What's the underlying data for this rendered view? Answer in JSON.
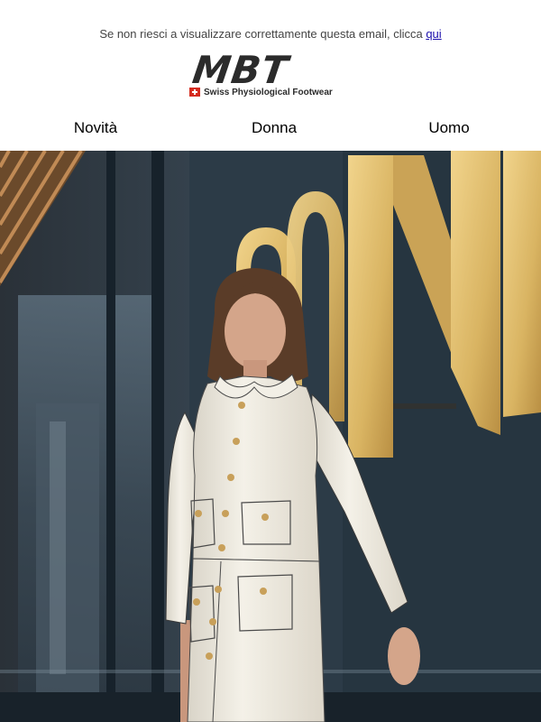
{
  "preheader": {
    "text": "Se non riesci a visualizzare correttamente questa email, clicca",
    "link": "qui"
  },
  "brand": {
    "name": "MBT",
    "tagline": "Swiss Physiological Footwear",
    "flag_color": "#d52b1e",
    "text_color": "#2b2b2b"
  },
  "nav": {
    "items": [
      {
        "label": "Novità"
      },
      {
        "label": "Donna"
      },
      {
        "label": "Uomo"
      }
    ]
  },
  "hero": {
    "signage_letters": "ONI",
    "signage_color": "#e0bc6a",
    "palette": {
      "wall": "#1f2a33",
      "jacket": "#eeeae0",
      "hair": "#5a3c28",
      "skin": "#d4a58a"
    }
  }
}
